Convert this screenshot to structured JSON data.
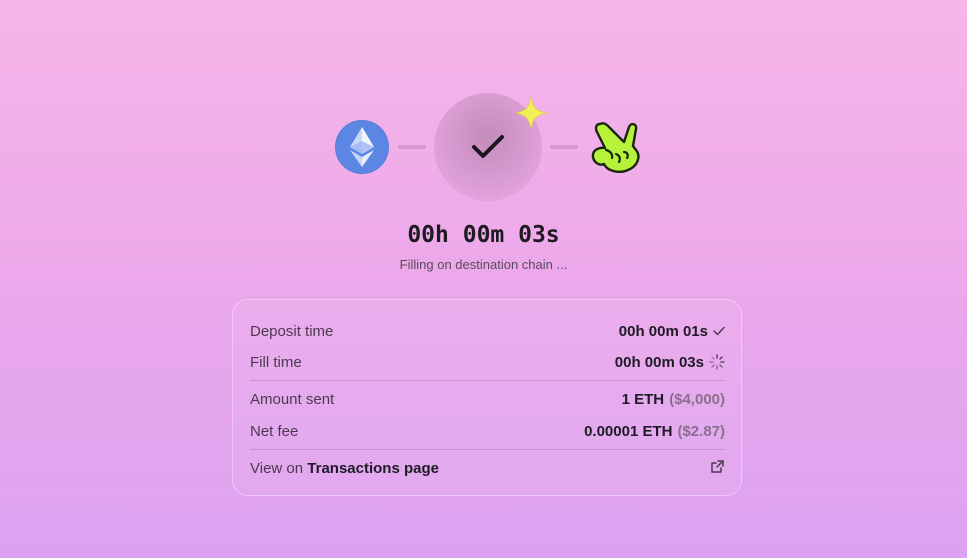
{
  "progress": {
    "source_chain_icon": "ethereum-icon",
    "status_icon": "checkmark-icon",
    "decoration_icon": "sparkle-icon",
    "destination_icon": "peace-hand-icon",
    "colors": {
      "ethereum": "#5c86e4",
      "peace_hand": "#b6f23a",
      "sparkle": "#f7f25c"
    }
  },
  "timer": {
    "value": "00h 00m 03s",
    "status": "Filling on destination chain ..."
  },
  "details": {
    "deposit_time": {
      "label": "Deposit time",
      "value": "00h 00m 01s",
      "icon": "check-icon"
    },
    "fill_time": {
      "label": "Fill time",
      "value": "00h 00m 03s",
      "icon": "spinner-icon"
    },
    "amount_sent": {
      "label": "Amount sent",
      "value": "1 ETH",
      "usd": "($4,000)"
    },
    "net_fee": {
      "label": "Net fee",
      "value": "0.00001 ETH",
      "usd": "($2.87)"
    },
    "view_link": {
      "prefix": "View on",
      "target": "Transactions page",
      "icon": "external-link-icon"
    }
  }
}
